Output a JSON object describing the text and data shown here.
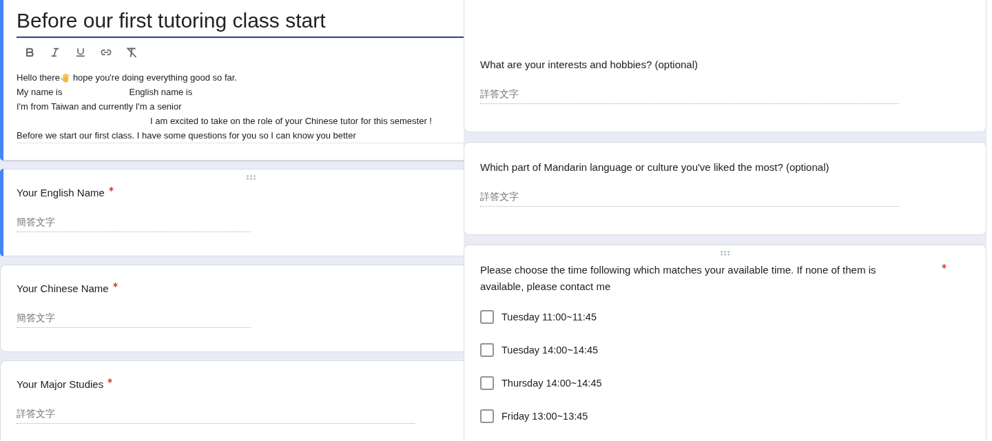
{
  "left_panel": {
    "form_header": {
      "title": "Before our first tutoring class start",
      "selected": true,
      "description": [
        {
          "parts": [
            {
              "kind": "text",
              "text": "Hello there"
            },
            {
              "kind": "emoji"
            },
            {
              "kind": "text",
              "text": "hope you're doing everything good so far."
            }
          ]
        },
        {
          "parts": [
            {
              "kind": "text",
              "text": "My name is"
            },
            {
              "kind": "blank"
            },
            {
              "kind": "text",
              "text": "English name is"
            }
          ]
        },
        {
          "parts": [
            {
              "kind": "text",
              "text": "I'm from Taiwan and currently I'm a senior"
            }
          ]
        },
        {
          "parts": [
            {
              "kind": "blank"
            },
            {
              "kind": "blank"
            },
            {
              "kind": "text",
              "text": "I am excited to take on the role of your Chinese tutor for this semester !"
            }
          ]
        },
        {
          "parts": [
            {
              "kind": "text",
              "text": "Before we start our first class. I have some questions for you so I can know you better"
            }
          ]
        }
      ]
    },
    "questions": [
      {
        "kind": "short_answer",
        "label": "Your English Name",
        "required": true,
        "placeholder": "簡答文字",
        "selected": true,
        "drag_handle": true
      },
      {
        "kind": "short_answer",
        "label": "Your Chinese Name",
        "required": true,
        "placeholder": "簡答文字",
        "selected": false,
        "drag_handle": false
      },
      {
        "kind": "paragraph",
        "label": "Your Major Studies",
        "required": true,
        "placeholder": "詳答文字",
        "selected": false,
        "drag_handle": false
      }
    ]
  },
  "right_panel": {
    "questions": [
      {
        "kind": "paragraph",
        "label": "What are your interests and hobbies? (optional)",
        "required": false,
        "placeholder": "詳答文字",
        "selected": false,
        "drag_handle": false
      },
      {
        "kind": "paragraph",
        "label": "Which part of Mandarin language or culture you've liked the most? (optional)",
        "required": false,
        "placeholder": "詳答文字",
        "selected": false,
        "drag_handle": false
      },
      {
        "kind": "checkboxes",
        "label": "Please choose the time following which matches your available time. If none of them is available, please contact me",
        "required": true,
        "selected": false,
        "drag_handle": true,
        "options": [
          {
            "label": "Tuesday 11:00~11:45",
            "checked": false
          },
          {
            "label": "Tuesday 14:00~14:45",
            "checked": false
          },
          {
            "label": "Thursday 14:00~14:45",
            "checked": false
          },
          {
            "label": "Friday 13:00~13:45",
            "checked": false
          }
        ]
      }
    ]
  }
}
